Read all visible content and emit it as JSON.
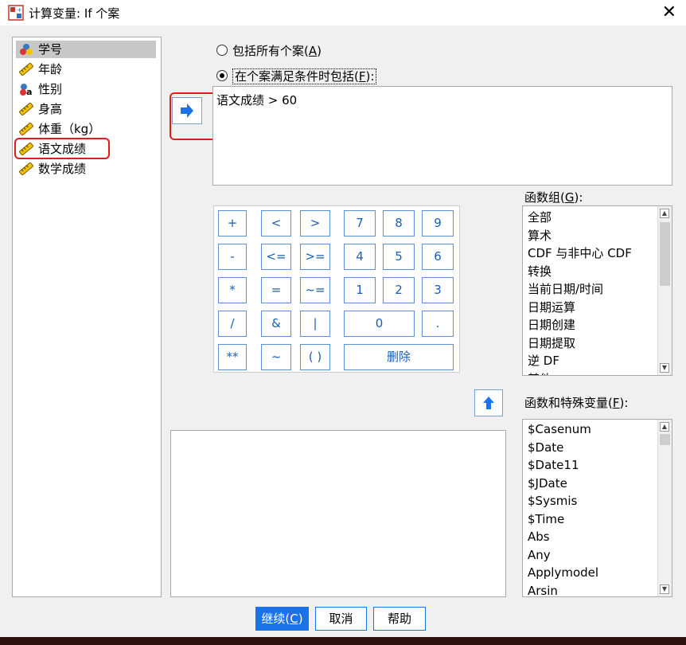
{
  "window": {
    "title": "计算变量: If 个案"
  },
  "variables": [
    {
      "label": "学号",
      "icon": "nominal-icon",
      "selected": true
    },
    {
      "label": "年龄",
      "icon": "scale-ruler-icon"
    },
    {
      "label": "性别",
      "icon": "string-nominal-icon"
    },
    {
      "label": "身高",
      "icon": "scale-ruler-icon"
    },
    {
      "label": "体重（kg）",
      "icon": "scale-ruler-icon"
    },
    {
      "label": "语文成绩",
      "icon": "scale-ruler-icon",
      "highlighted": true
    },
    {
      "label": "数学成绩",
      "icon": "scale-ruler-icon"
    }
  ],
  "options": {
    "all_cases": {
      "text": "包括所有个案(",
      "key": "A",
      "end": ")",
      "selected": false
    },
    "condition": {
      "text": "在个案满足条件时包括(",
      "key": "F",
      "end": "):",
      "selected": true
    }
  },
  "condition_expression": "语文成绩 > 60",
  "keypad": {
    "keys": [
      "+",
      "<",
      ">",
      "7",
      "8",
      "9",
      "-",
      "<=",
      ">=",
      "4",
      "5",
      "6",
      "*",
      "=",
      "~=",
      "1",
      "2",
      "3",
      "/",
      "&",
      "|",
      "0",
      ".",
      "**",
      "~",
      "( )",
      "删除"
    ]
  },
  "function_group": {
    "label": "函数组(",
    "key": "G",
    "end": "):",
    "items": [
      "全部",
      "算术",
      "CDF 与非中心 CDF",
      "转换",
      "当前日期/时间",
      "日期运算",
      "日期创建",
      "日期提取",
      "逆 DF",
      "其他"
    ]
  },
  "functions": {
    "label": "函数和特殊变量(",
    "key": "F",
    "end": "):",
    "items": [
      "$Casenum",
      "$Date",
      "$Date11",
      "$JDate",
      "$Sysmis",
      "$Time",
      "Abs",
      "Any",
      "Applymodel",
      "Arsin"
    ]
  },
  "buttons": {
    "continue": {
      "text": "继续(",
      "key": "C",
      "end": ")"
    },
    "cancel": "取消",
    "help": "帮助"
  },
  "colors": {
    "accent": "#1a73e8",
    "highlight": "#e31b1b"
  }
}
